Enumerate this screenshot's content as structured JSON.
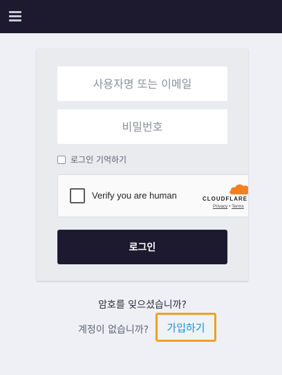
{
  "header": {
    "menu_icon": "hamburger-menu-icon"
  },
  "login_form": {
    "username_placeholder": "사용자명 또는 이메일",
    "password_placeholder": "비밀번호",
    "remember_label": "로그인 기억하기",
    "captcha": {
      "label": "Verify you are human",
      "brand": "CLOUDFLARE",
      "privacy_link": "Privacy",
      "separator": "•",
      "terms_link": "Terms"
    },
    "submit_label": "로그인"
  },
  "footer": {
    "forgot_password": "암호를 잊으셨습니까?",
    "no_account_text": "계정이 없습니까?",
    "signup_link": "가입하기"
  },
  "colors": {
    "topbar": "#1d1a2f",
    "button": "#1d1a2f",
    "link": "#1a8fd6",
    "highlight_border": "#f0a020",
    "cloudflare_orange": "#f38020"
  }
}
